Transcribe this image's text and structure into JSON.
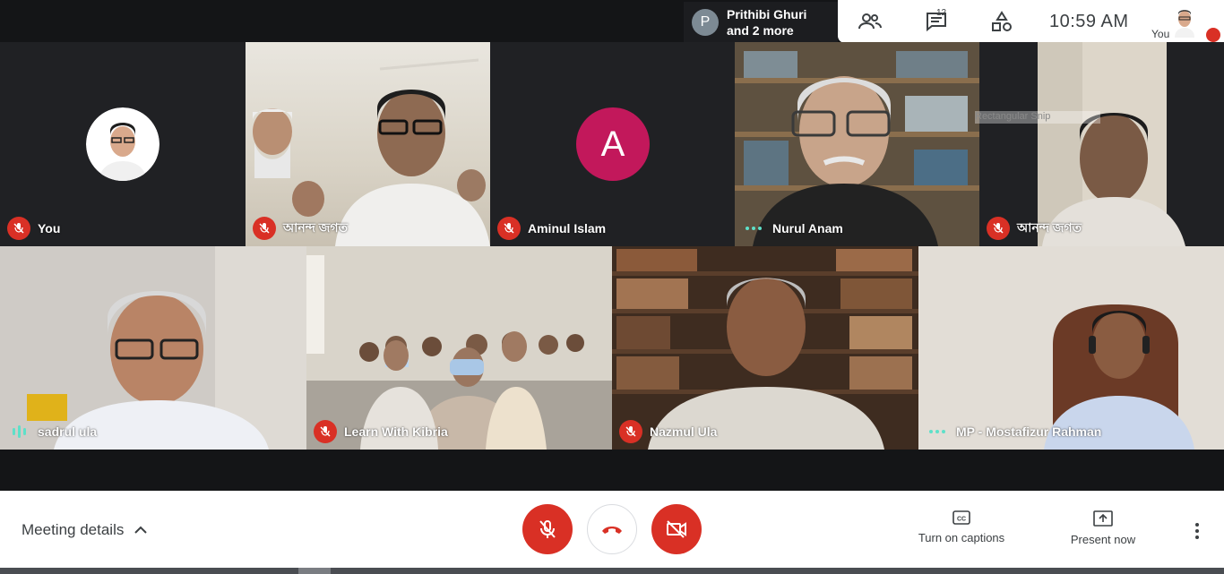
{
  "presenter": {
    "avatar_letter": "P",
    "line1": "Prithibi Ghuri",
    "line2": "and 2 more"
  },
  "toolbar": {
    "participants_icon": "people-icon",
    "participants_count": "12",
    "chat_icon": "chat-icon",
    "activities_icon": "shapes-icon",
    "time": "10:59  AM",
    "self_label": "You"
  },
  "tiles": [
    {
      "name": "You",
      "status": "muted"
    },
    {
      "name": "আনন্দ জগত",
      "status": "muted"
    },
    {
      "name": "Aminul Islam",
      "status": "muted",
      "avatar_letter": "A"
    },
    {
      "name": "Nurul Anam",
      "status": "active-dots"
    },
    {
      "name": "আনন্দ জগত",
      "status": "muted"
    },
    {
      "name": "sadrul ula",
      "status": "speaking"
    },
    {
      "name": "Learn With Kibria",
      "status": "muted"
    },
    {
      "name": "Nazmul Ula",
      "status": "muted"
    },
    {
      "name": "MP - Mostafizur Rahman",
      "status": "active-dots"
    }
  ],
  "overlay": {
    "snip_text": "Rectangular Snip"
  },
  "bottombar": {
    "meeting_details": "Meeting details",
    "captions_label": "Turn on captions",
    "present_label": "Present now"
  },
  "colors": {
    "danger": "#d93025",
    "accent_green": "#5ee0c9",
    "avatar_pink": "#c2185b"
  }
}
